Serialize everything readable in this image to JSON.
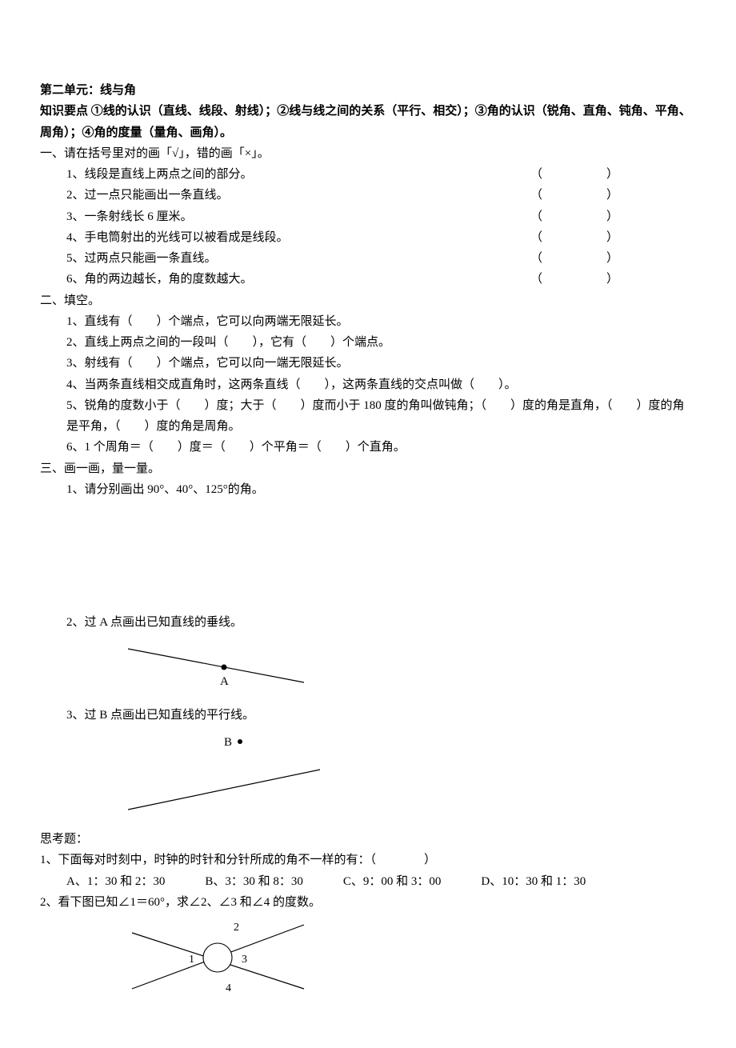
{
  "header": {
    "unit_title": "第二单元：线与角",
    "knowledge_label": "知识要点",
    "knowledge_points": " ①线的认识（直线、线段、射线）；②线与线之间的关系（平行、相交）；③角的认识（锐角、直角、钝角、平角、周角）；④角的度量（量角、画角）。"
  },
  "sec1": {
    "title": "一、请在括号里对的画「√」，错的画「×」。",
    "items": [
      "1、线段是直线上两点之间的部分。",
      "2、过一点只能画出一条直线。",
      "3、一条射线长 6 厘米。",
      "4、手电筒射出的光线可以被看成是线段。",
      "5、过两点只能画一条直线。",
      "6、角的两边越长，角的度数越大。"
    ],
    "paren_left": "（",
    "paren_right": "）"
  },
  "sec2": {
    "title": "二、填空。",
    "items": [
      "1、直线有（　　）个端点，它可以向两端无限延长。",
      "2、直线上两点之间的一段叫（　　），它有（　　）个端点。",
      "3、射线有（　　）个端点，它可以向一端无限延长。",
      "4、当两条直线相交成直角时，这两条直线（　　），这两条直线的交点叫做（　　）。",
      "5、锐角的度数小于（　　）度；大于（　　）度而小于 180 度的角叫做钝角；（　　）度的角是直角，（　　）度的角是平角，（　　）度的角是周角。",
      "6、1 个周角＝（　　）度＝（　　）个平角＝（　　）个直角。"
    ]
  },
  "sec3": {
    "title": "三、画一画，量一量。",
    "q1": "1、请分别画出 90°、40°、125°的角。",
    "q2": "2、过 A 点画出已知直线的垂线。",
    "q2_label": "A",
    "q3": "3、过 B 点画出已知直线的平行线。",
    "q3_label": "B"
  },
  "think": {
    "title": "思考题：",
    "q1": "1、下面每对时刻中，时钟的时针和分针所成的角不一样的有：（　　　　）",
    "options": {
      "a": "A、1：30 和 2：30",
      "b": "B、3：30 和 8：30",
      "c": "C、9：00 和 3：00",
      "d": "D、10：30 和 1：30"
    },
    "q2": "2、看下图已知∠1＝60°，求∠2、∠3 和∠4 的度数。",
    "angle_labels": {
      "a1": "1",
      "a2": "2",
      "a3": "3",
      "a4": "4"
    }
  }
}
